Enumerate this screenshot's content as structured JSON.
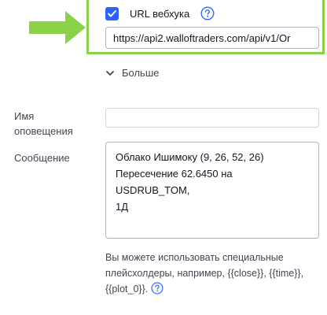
{
  "webhook": {
    "checked": true,
    "label": "URL вебхука",
    "url_value": "https://api2.walloftraders.com/api/v1/Or"
  },
  "more": {
    "label": "Больше"
  },
  "alert_name": {
    "label": "Имя оповещения",
    "value": ""
  },
  "message": {
    "label": "Сообщение",
    "value": "Облако Ишимоку (9, 26, 52, 26)\nПересечение 62.6450 на USDRUB_TOM,\n1Д"
  },
  "hint": {
    "text": "Вы можете использовать специальные плейсхолдеры, например, {{close}}, {{time}}, {{plot_0}}."
  },
  "colors": {
    "accent": "#2962ff",
    "highlight": "#8cd14a"
  },
  "icons": {
    "checkbox": "check-icon",
    "help": "question-circle-icon",
    "chevron": "chevron-down-icon",
    "arrow": "green-arrow-icon"
  }
}
